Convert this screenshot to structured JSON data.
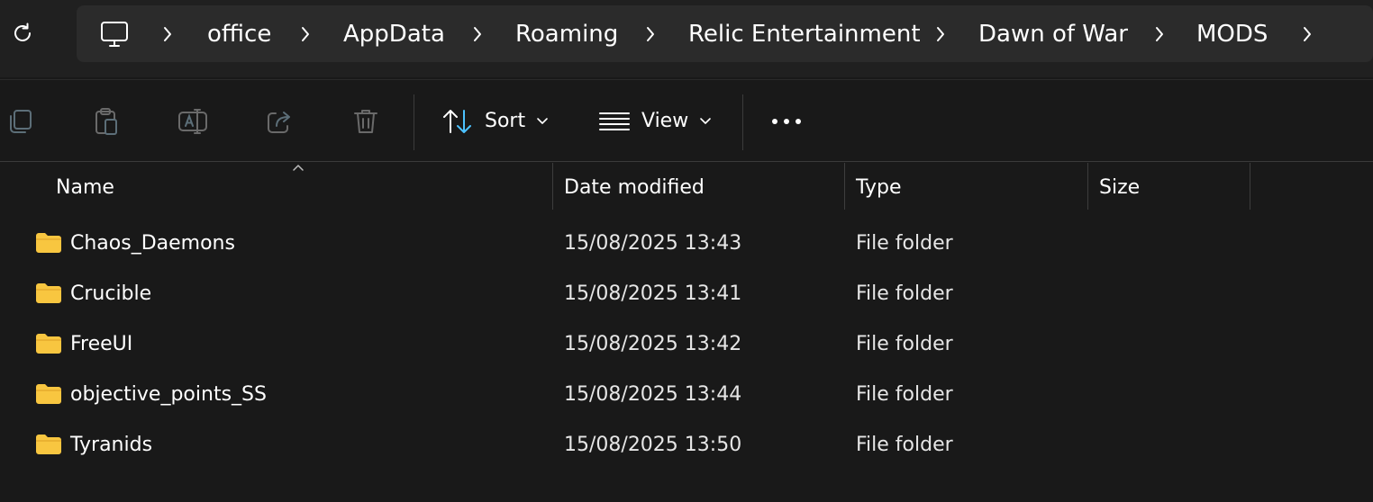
{
  "breadcrumb": {
    "items": [
      {
        "label": "office"
      },
      {
        "label": "AppData"
      },
      {
        "label": "Roaming"
      },
      {
        "label": "Relic Entertainment"
      },
      {
        "label": "Dawn of War"
      },
      {
        "label": "MODS"
      }
    ]
  },
  "icons": {
    "refresh": "refresh-icon",
    "pc": "monitor-icon",
    "chevron": "chevron-right-icon",
    "copy": "copy-icon",
    "paste": "paste-icon",
    "rename": "rename-icon",
    "share": "share-icon",
    "delete": "trash-icon",
    "sort": "sort-arrows-icon",
    "view": "view-lines-icon",
    "more": "more-dots-icon",
    "folder": "folder-icon"
  },
  "toolbar": {
    "sort_label": "Sort",
    "view_label": "View"
  },
  "columns": {
    "name": "Name",
    "date": "Date modified",
    "type": "Type",
    "size": "Size"
  },
  "files": [
    {
      "name": "Chaos_Daemons",
      "date": "15/08/2025 13:43",
      "type": "File folder",
      "size": ""
    },
    {
      "name": "Crucible",
      "date": "15/08/2025 13:41",
      "type": "File folder",
      "size": ""
    },
    {
      "name": "FreeUI",
      "date": "15/08/2025 13:42",
      "type": "File folder",
      "size": ""
    },
    {
      "name": "objective_points_SS",
      "date": "15/08/2025 13:44",
      "type": "File folder",
      "size": ""
    },
    {
      "name": "Tyranids",
      "date": "15/08/2025 13:50",
      "type": "File folder",
      "size": ""
    }
  ],
  "colors": {
    "background": "#191919",
    "addressbar": "#202020",
    "breadcrumb_bg": "#2b2b2b",
    "accent": "#4cc2ff",
    "folder": "#f8c640"
  }
}
